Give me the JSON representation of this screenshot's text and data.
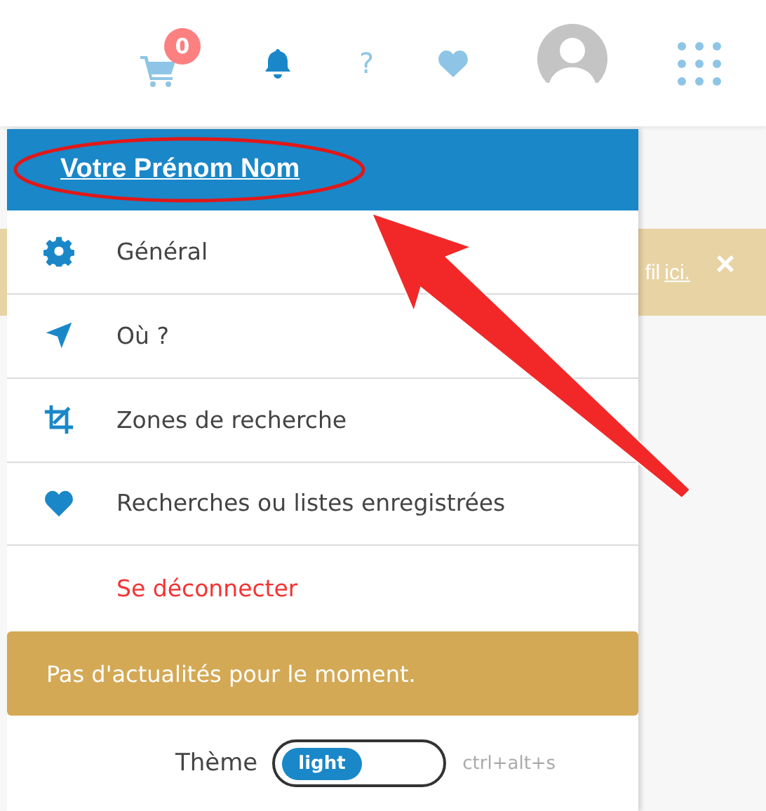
{
  "header": {
    "cart_count": "0",
    "help": "?"
  },
  "banner": {
    "text": "fil",
    "link": "ici.",
    "close": "×"
  },
  "menu": {
    "user_name": "Votre Prénom Nom",
    "items": [
      {
        "kind": "link",
        "label": "Général"
      },
      {
        "kind": "link",
        "label": "Où ?"
      },
      {
        "kind": "link",
        "label": "Zones de recherche"
      },
      {
        "kind": "link",
        "label": "Recherches ou listes enregistrées"
      },
      {
        "kind": "danger",
        "label": "Se déconnecter"
      }
    ],
    "news": "Pas d'actualités pour le moment.",
    "theme": {
      "label": "Thème",
      "value": "light",
      "dark": false,
      "shortcut": "ctrl+alt+s"
    }
  }
}
